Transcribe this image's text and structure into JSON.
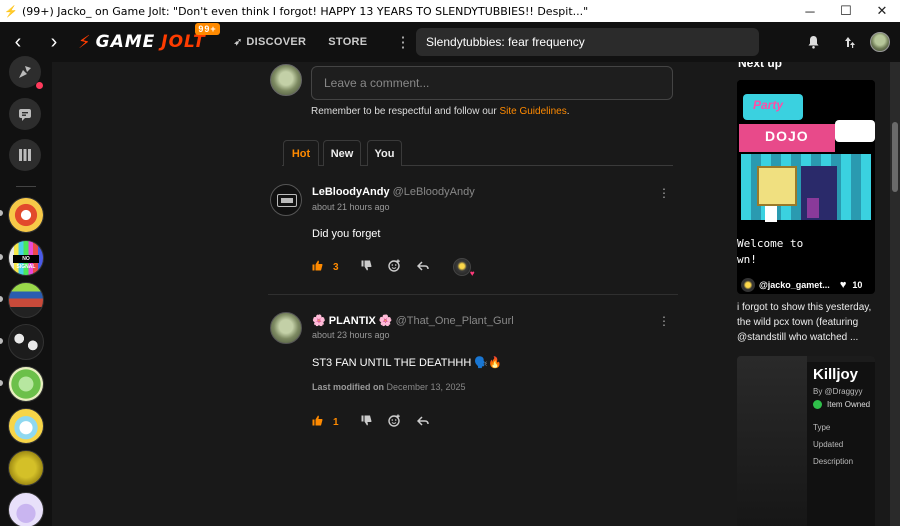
{
  "window": {
    "title": "(99+) Jacko_ on Game Jolt: \"Don't even think I forgot! HAPPY 13 YEARS TO SLENDYTUBBIES!! Despit...\"",
    "minimize": "─",
    "maximize": "☐",
    "close": "✕"
  },
  "nav": {
    "back": "‹",
    "forward": "›",
    "logo_game": "GAME",
    "logo_jolt": "JOLT",
    "notif_badge": "99+",
    "discover": "DISCOVER",
    "store": "STORE",
    "search_value": "Slendytubbies: fear frequency"
  },
  "comment_box": {
    "placeholder": "Leave a comment...",
    "guidelines_prefix": "Remember to be respectful and follow our ",
    "guidelines_link": "Site Guidelines",
    "guidelines_suffix": "."
  },
  "tabs": [
    "Hot",
    "New",
    "You"
  ],
  "comments": [
    {
      "name": "LeBloodyAndy",
      "handle": "@LeBloodyAndy",
      "time": "about 21 hours ago",
      "body": "Did you forget",
      "likes": "3"
    },
    {
      "name": "🌸 PLANTIX 🌸",
      "handle": "@That_One_Plant_Gurl",
      "time": "about 23 hours ago",
      "body": "ST3 FAN UNTIL THE DEATHHH 🗣️🔥",
      "modified_label": "Last modified on",
      "modified_date": "December 13, 2025",
      "likes": "1"
    }
  ],
  "sidebar_right": {
    "next_up": "Next up",
    "card1": {
      "sign_top": "Party",
      "sign_bottom": "DOJO",
      "text_line1": "Welcome to",
      "text_line2": "wn!",
      "user": "@jacko_gamet...",
      "likes": "10",
      "caption": "i forgot to show this yesterday, the wild pcx town (featuring @standstill  who watched ..."
    },
    "card2": {
      "title": "Killjoy",
      "by": "By @Draggyy",
      "owned": "Item Owned",
      "rows": [
        "Type",
        "Updated",
        "Description"
      ]
    }
  },
  "colors": {
    "accent": "#ff8a00",
    "brand_red": "#ff3c00",
    "background": "#191919"
  }
}
